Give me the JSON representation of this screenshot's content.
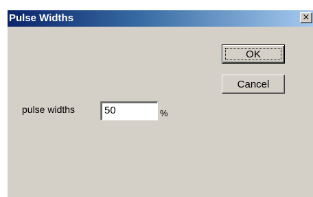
{
  "window": {
    "title": "Pulse Widths",
    "close_glyph": "×",
    "close_icon": "close-icon"
  },
  "buttons": {
    "ok_label": "OK",
    "cancel_label": "Cancel"
  },
  "form": {
    "pulse_widths_label": "pulse widths",
    "pulse_widths_value": "50",
    "unit": "%"
  },
  "colors": {
    "face": "#d4d0c8",
    "title_start": "#0a246a",
    "title_end": "#a6caf0"
  }
}
